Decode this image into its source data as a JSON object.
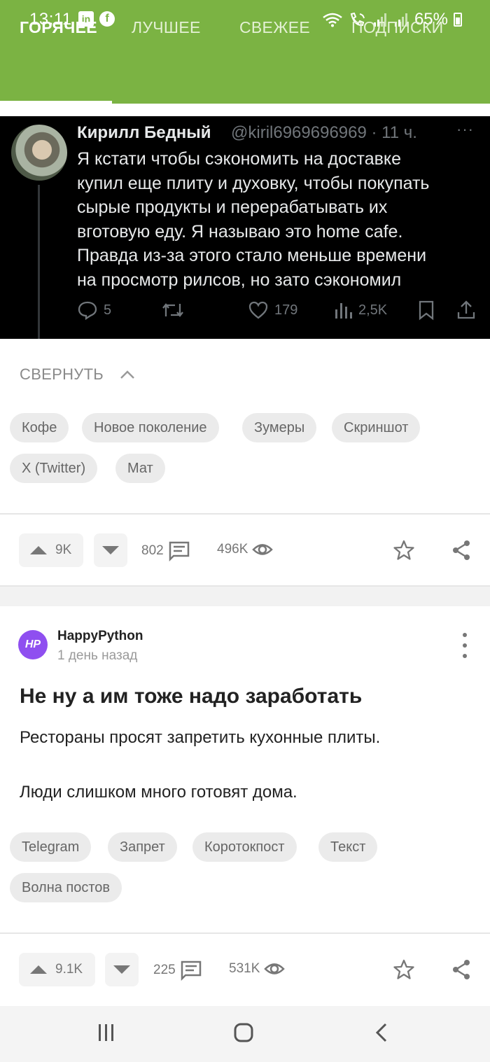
{
  "status_bar": {
    "time": "13:11",
    "left_icons": [
      "linkedin-icon",
      "facebook-icon"
    ],
    "right_icons": [
      "wifi-icon",
      "call-icon",
      "signal-icon",
      "signal-icon"
    ],
    "battery": "65%"
  },
  "tabs": [
    {
      "label": "ГОРЯЧЕЕ",
      "active": true
    },
    {
      "label": "ЛУЧШЕЕ",
      "active": false
    },
    {
      "label": "СВЕЖЕЕ",
      "active": false
    },
    {
      "label": "ПОДПИСКИ",
      "active": false
    }
  ],
  "colors": {
    "brand": "#7bb343",
    "avatar_hp": "#8f4ff0"
  },
  "post1": {
    "tweet": {
      "name": "Кирилл Бедный",
      "handle": "@kiril6969696969 · 11 ч.",
      "more": "···",
      "lines": [
        "Я кстати чтобы сэкономить на доставке",
        "купил еще плиту и духовку, чтобы покупать",
        "сырые продукты и перерабатывать их",
        "вготовую еду. Я называю это home cafe.",
        "Правда из-за этого стало меньше времени",
        "на просмотр рилсов, но зато сэкономил"
      ],
      "replies": "5",
      "likes": "179",
      "views": "2,5K"
    },
    "collapse_label": "СВЕРНУТЬ",
    "tags": [
      "Кофе",
      "Новое поколение",
      "Зумеры",
      "Скриншот",
      "X (Twitter)",
      "Мат"
    ],
    "rating": "9K",
    "comments": "802",
    "views": "496K"
  },
  "post2": {
    "avatar_text": "HP",
    "author": "HappyPython",
    "time": "1 день назад",
    "title": "Не ну а им тоже надо заработать",
    "paragraphs": [
      "Рестораны просят запретить кухонные плиты.",
      "Люди слишком много готовят дома."
    ],
    "tags": [
      "Telegram",
      "Запрет",
      "Коротокпост",
      "Текст",
      "Волна постов"
    ],
    "rating": "9.1K",
    "comments": "225",
    "views": "531K"
  }
}
